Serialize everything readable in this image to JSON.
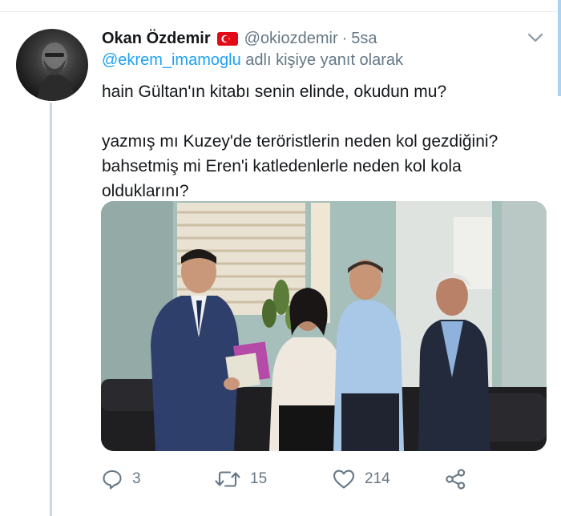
{
  "tweet": {
    "author": {
      "display_name": "Okan Özdemir",
      "handle": "@okiozdemir",
      "separator": "·",
      "timestamp": "5sa"
    },
    "reply_to": {
      "mention": "@ekrem_imamoglu",
      "suffix": "adlı kişiye yanıt olarak"
    },
    "text": {
      "line1": "hain Gültan'ın kitabı senin elinde, okudun mu?",
      "line2": "yazmış mı Kuzey'de teröristlerin neden kol gezdiğini?",
      "line3": "bahsetmiş mi Eren'i katledenlerle neden kol kola",
      "line4": "olduklarını?"
    },
    "actions": {
      "reply_count": "3",
      "retweet_count": "15",
      "like_count": "214"
    }
  },
  "icons": {
    "flag": "turkey-flag-icon",
    "menu": "chevron-down-icon",
    "reply": "reply-icon",
    "retweet": "retweet-icon",
    "like": "heart-icon",
    "share": "share-icon"
  },
  "colors": {
    "link": "#1da1f2",
    "secondary_text": "#657786",
    "primary_text": "#14171a",
    "thread_line": "#ccd6dd",
    "flag_red": "#e30a17"
  }
}
